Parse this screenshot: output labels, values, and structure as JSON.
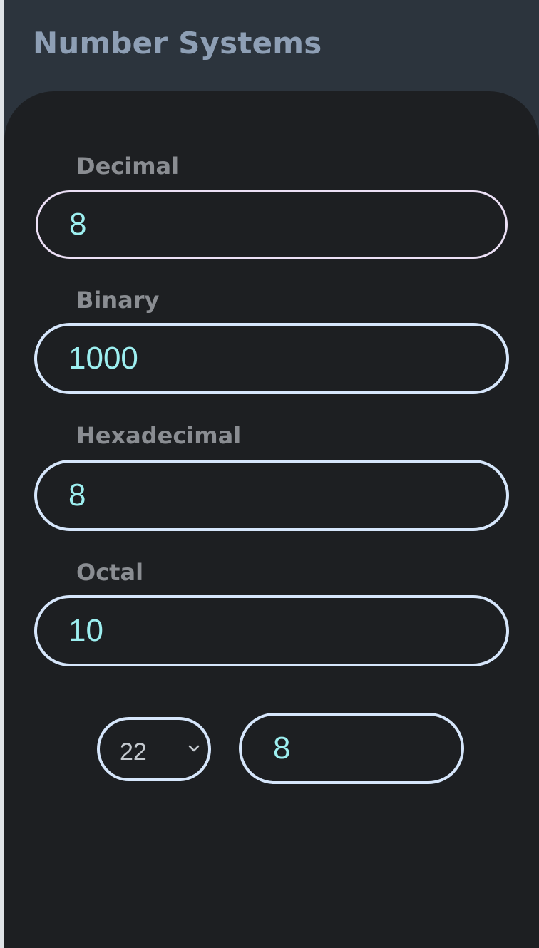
{
  "header": {
    "title": "Number Systems"
  },
  "fields": {
    "decimal": {
      "label": "Decimal",
      "value": "8"
    },
    "binary": {
      "label": "Binary",
      "value": "1000"
    },
    "hexadecimal": {
      "label": "Hexadecimal",
      "value": "8"
    },
    "octal": {
      "label": "Octal",
      "value": "10"
    }
  },
  "custom_base": {
    "selected_base": "22",
    "result": "8"
  },
  "icons": {
    "select_arrow": "chevron-down-icon"
  },
  "colors": {
    "header_bg": "#2c343d",
    "panel_bg": "#1d1f22",
    "title": "#8e9fb5",
    "label": "#8a8d92",
    "input_border": "#d6e6fb",
    "input_border_active": "#ece0f6",
    "input_text": "#9deff0"
  }
}
